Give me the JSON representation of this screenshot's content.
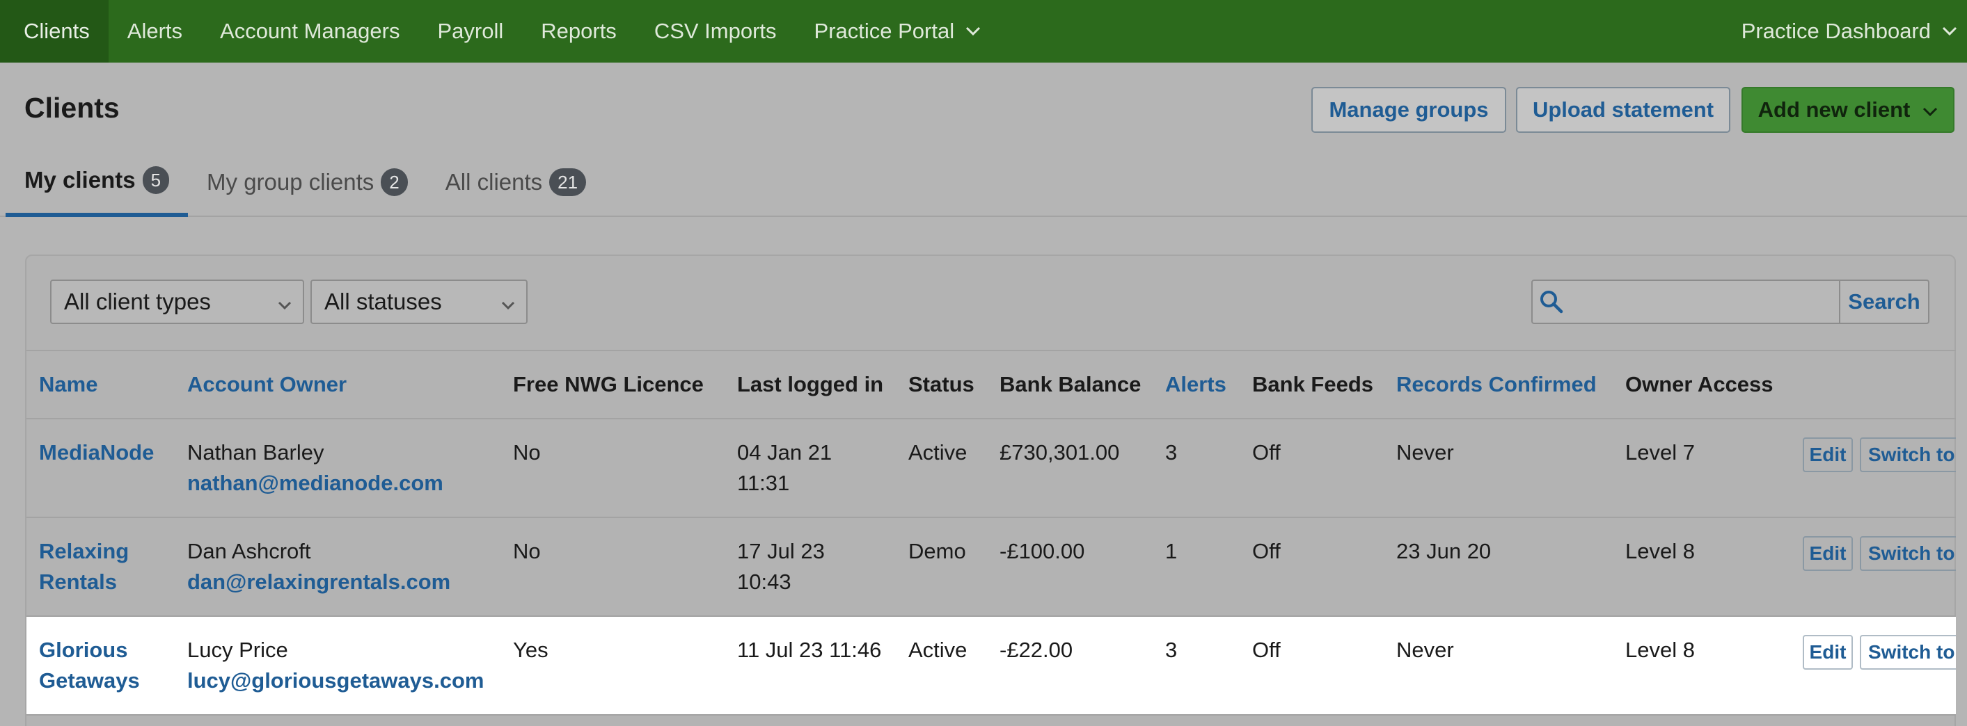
{
  "nav": {
    "items": [
      "Clients",
      "Alerts",
      "Account Managers",
      "Payroll",
      "Reports",
      "CSV Imports",
      "Practice Portal"
    ],
    "right": "Practice Dashboard"
  },
  "header": {
    "title": "Clients",
    "manage_groups": "Manage groups",
    "upload_statement": "Upload statement",
    "add_client": "Add new client"
  },
  "tabs": [
    {
      "label": "My clients",
      "count": "5"
    },
    {
      "label": "My group clients",
      "count": "2"
    },
    {
      "label": "All clients",
      "count": "21"
    }
  ],
  "filters": {
    "client_type": "All client types",
    "status": "All statuses",
    "search_placeholder": "",
    "search_button": "Search"
  },
  "table": {
    "headers": [
      "Name",
      "Account Owner",
      "Free NWG Licence",
      "Last logged in",
      "Status",
      "Bank Balance",
      "Alerts",
      "Bank Feeds",
      "Records Confirmed",
      "Owner Access"
    ],
    "rows": [
      {
        "name_l1": "MediaNode",
        "name_l2": "",
        "owner": "Nathan Barley",
        "email": "nathan@medianode.com",
        "licence": "No",
        "login_l1": "04 Jan 21",
        "login_l2": "11:31",
        "status": "Active",
        "balance": "£730,301.00",
        "alerts": "3",
        "feeds": "Off",
        "confirmed": "Never",
        "access": "Level 7",
        "edit": "Edit",
        "switch": "Switch to"
      },
      {
        "name_l1": "Relaxing",
        "name_l2": "Rentals",
        "owner": "Dan Ashcroft",
        "email": "dan@relaxingrentals.com",
        "licence": "No",
        "login_l1": "17 Jul 23",
        "login_l2": "10:43",
        "status": "Demo",
        "balance": "-£100.00",
        "alerts": "1",
        "feeds": "Off",
        "confirmed": "23 Jun 20",
        "access": "Level 8",
        "edit": "Edit",
        "switch": "Switch to"
      },
      {
        "name_l1": "Glorious",
        "name_l2": "Getaways",
        "owner": "Lucy Price",
        "email": "lucy@gloriousgetaways.com",
        "licence": "Yes",
        "login_l1": "11 Jul 23 11:46",
        "login_l2": "",
        "status": "Active",
        "balance": "-£22.00",
        "alerts": "3",
        "feeds": "Off",
        "confirmed": "Never",
        "access": "Level 8",
        "edit": "Edit",
        "switch": "Switch to"
      }
    ]
  },
  "colors": {
    "nav_bg": "#2c6a1c",
    "link": "#1f5c94",
    "primary_button": "#3f8a32"
  }
}
